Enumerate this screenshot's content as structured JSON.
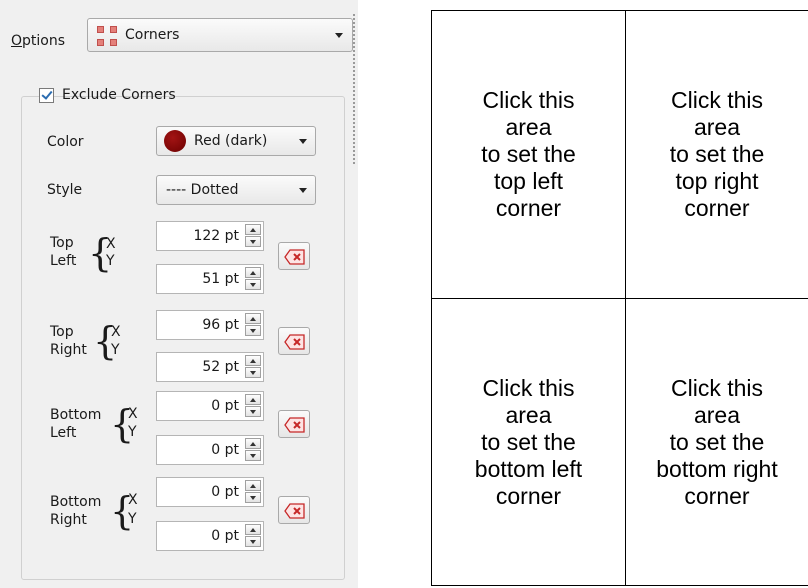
{
  "options": {
    "label_prefix": "O",
    "label_rest": "ptions",
    "selected": "Corners",
    "icon": "corners-icon"
  },
  "group": {
    "checkbox_label": "Exclude Corners",
    "checked": true
  },
  "color": {
    "label": "Color",
    "value": "Red (dark)",
    "swatch": "#7a0a0a"
  },
  "style": {
    "label": "Style",
    "value": "---- Dotted"
  },
  "corners": [
    {
      "label1": "Top",
      "label2": "Left",
      "x_label": "X",
      "y_label": "Y",
      "x": "122 pt",
      "y": "51 pt",
      "clear_icon": "clear-icon"
    },
    {
      "label1": "Top",
      "label2": "Right",
      "x_label": "X",
      "y_label": "Y",
      "x": "96 pt",
      "y": "52 pt",
      "clear_icon": "clear-icon"
    },
    {
      "label1": "Bottom",
      "label2": "Left",
      "x_label": "X",
      "y_label": "Y",
      "x": "0 pt",
      "y": "0 pt",
      "clear_icon": "clear-icon"
    },
    {
      "label1": "Bottom",
      "label2": "Right",
      "x_label": "X",
      "y_label": "Y",
      "x": "0 pt",
      "y": "0 pt",
      "clear_icon": "clear-icon"
    }
  ],
  "grid": {
    "top_left": [
      "Click this",
      "area",
      "to set the",
      "top left",
      "corner"
    ],
    "top_right": [
      "Click this",
      "area",
      "to set the",
      "top right",
      "corner"
    ],
    "bottom_left": [
      "Click this",
      "area",
      "to set the",
      "bottom left",
      "corner"
    ],
    "bottom_right": [
      "Click this",
      "area",
      "to set the",
      "bottom right",
      "corner"
    ]
  }
}
